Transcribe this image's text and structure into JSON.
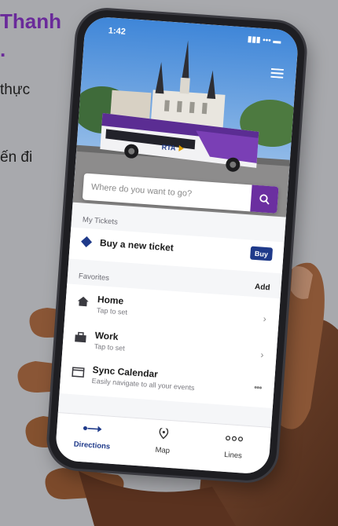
{
  "background": {
    "heading_lines": [
      "Thanh",
      "."
    ],
    "body_lines": [
      "thực",
      "ến đi"
    ]
  },
  "status": {
    "time": "1:42",
    "icons": "▮▮▮ ••• ▬"
  },
  "search": {
    "placeholder": "Where do you want to go?"
  },
  "bus": {
    "brand": "RTA"
  },
  "tickets": {
    "section_label": "My Tickets",
    "buy_new_label": "Buy a new ticket",
    "buy_button": "Buy"
  },
  "favorites": {
    "section_label": "Favorites",
    "add_label": "Add",
    "items": [
      {
        "title": "Home",
        "subtitle": "Tap to set",
        "icon": "home-icon"
      },
      {
        "title": "Work",
        "subtitle": "Tap to set",
        "icon": "briefcase-icon"
      },
      {
        "title": "Sync Calendar",
        "subtitle": "Easily navigate to all your events",
        "icon": "calendar-icon"
      }
    ]
  },
  "nav": {
    "items": [
      {
        "label": "Directions",
        "icon": "directions-icon",
        "active": true
      },
      {
        "label": "Map",
        "icon": "map-pin-icon",
        "active": false
      },
      {
        "label": "Lines",
        "icon": "lines-icon",
        "active": false
      }
    ]
  },
  "colors": {
    "accent_purple": "#6b2fa0",
    "buy_blue": "#1f3a8a",
    "page_bg": "#a8a9ad"
  }
}
